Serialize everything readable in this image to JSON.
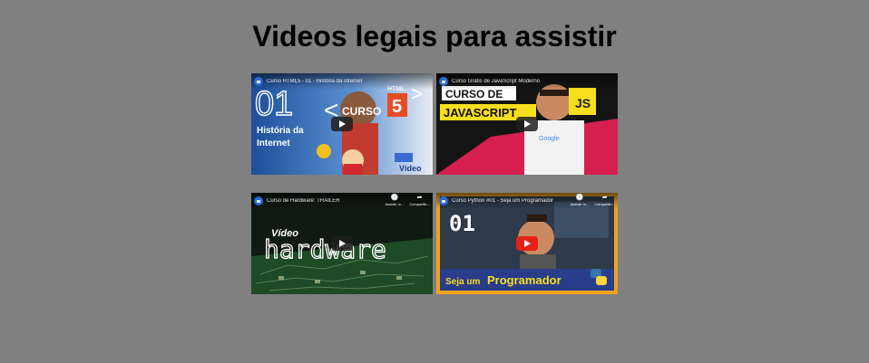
{
  "page": {
    "title": "Videos legais para assistir"
  },
  "videos": [
    {
      "title": "Curso HTML5 - 01 - História da Internet",
      "thumb_big": "01",
      "thumb_word1": "CURSO",
      "thumb_badge": "HTML",
      "thumb_caption1": "História da",
      "thumb_caption2": "Internet",
      "thumb_logo": "Vídeo",
      "actions": []
    },
    {
      "title": "Curso Grátis de JavaScript Moderno",
      "thumb_word1": "CURSO DE",
      "thumb_word2": "JAVASCRIPT",
      "thumb_badge": "JS",
      "thumb_shirt": "Google",
      "actions": []
    },
    {
      "title": "Curso de Hardware: TRAILER",
      "thumb_word1": "Vídeo",
      "thumb_word2": "hardware",
      "actions": [
        {
          "icon": "clock-icon",
          "label": "Assistir m..."
        },
        {
          "icon": "share-icon",
          "label": "Compartilh..."
        }
      ]
    },
    {
      "title": "Curso Python #01 - Seja um Programador",
      "thumb_big": "01",
      "thumb_caption1": "Seja um",
      "thumb_caption2": "Programador",
      "actions": [
        {
          "icon": "clock-icon",
          "label": "Assistir m..."
        },
        {
          "icon": "share-icon",
          "label": "Compartilh..."
        }
      ]
    }
  ],
  "colors": {
    "background": "#808080",
    "youtube_red": "#e62117",
    "html5_orange": "#e44d26",
    "js_yellow": "#f7df1e",
    "python_yellow": "#f0a41c"
  }
}
